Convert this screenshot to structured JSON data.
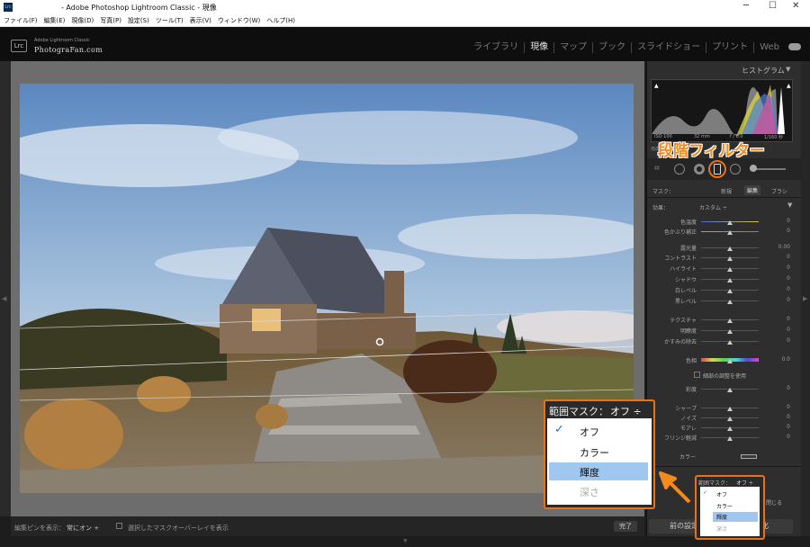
{
  "window": {
    "title": "- Adobe Photoshop Lightroom Classic - 現像",
    "app_icon": "Lrc"
  },
  "menu": [
    "ファイル(F)",
    "編集(E)",
    "現像(D)",
    "写真(P)",
    "設定(S)",
    "ツール(T)",
    "表示(V)",
    "ウィンドウ(W)",
    "ヘルプ(H)"
  ],
  "brand": {
    "logo": "Lrc",
    "small": "Adobe Lightroom Classic",
    "name": "PhotograFan.com"
  },
  "modules": [
    "ライブラリ",
    "現像",
    "マップ",
    "ブック",
    "スライドショー",
    "プリント",
    "Web"
  ],
  "histogram": {
    "title": "ヒストグラム",
    "iso": "ISO 100",
    "focal": "32 mm",
    "aperture": "f / 8.0",
    "shutter": "1/160 秒",
    "label": "元の写真"
  },
  "annotation": {
    "title": "段階フィルター",
    "color": "#f28a1e"
  },
  "mask": {
    "label": "マスク：",
    "new": "新規",
    "edit": "編集",
    "brush": "ブラシ"
  },
  "effect": {
    "label": "効果：",
    "value": "カスタム ÷"
  },
  "sliders": [
    {
      "name": "色温度",
      "value": "0"
    },
    {
      "name": "色かぶり補正",
      "value": "0"
    },
    {
      "name": "露光量",
      "value": "0.00"
    },
    {
      "name": "コントラスト",
      "value": "0"
    },
    {
      "name": "ハイライト",
      "value": "0"
    },
    {
      "name": "シャドウ",
      "value": "0"
    },
    {
      "name": "白レベル",
      "value": "0"
    },
    {
      "name": "黒レベル",
      "value": "0"
    },
    {
      "name": "テクスチャ",
      "value": "0"
    },
    {
      "name": "明瞭度",
      "value": "0"
    },
    {
      "name": "かすみの除去",
      "value": "0"
    },
    {
      "name": "色相",
      "value": "0.0"
    },
    {
      "name": "彩度",
      "value": "0"
    },
    {
      "name": "シャープ",
      "value": "0"
    },
    {
      "name": "ノイズ",
      "value": "0"
    },
    {
      "name": "モアレ",
      "value": "0"
    },
    {
      "name": "フリンジ軽減",
      "value": "0"
    }
  ],
  "fine_adjust": "細部の調整を使用",
  "color_label": "カラー",
  "range_mask": {
    "label": "範囲マスク：",
    "value": "オフ ÷",
    "options": [
      "オフ",
      "カラー",
      "輝度",
      "深さ"
    ],
    "selected": "オフ",
    "highlighted": "輝度",
    "disabled": "深さ"
  },
  "close_label": "閉じる",
  "bottom": {
    "show_pins_label": "編集ピンを表示：",
    "show_pins_value": "常にオン ÷",
    "overlay_label": "選択したマスクオーバーレイを表示",
    "done": "完了"
  },
  "buttons": {
    "prev": "前の設定",
    "reset": "初期化"
  }
}
